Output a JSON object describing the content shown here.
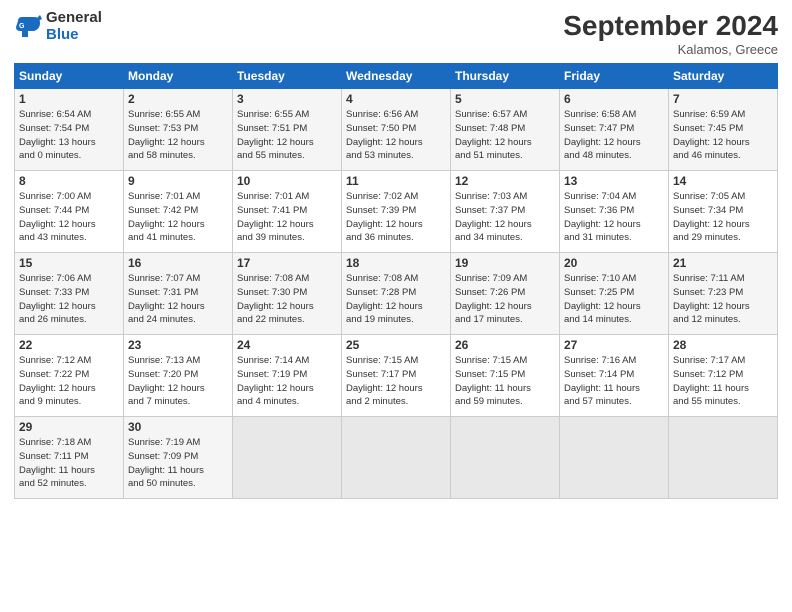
{
  "header": {
    "logo_general": "General",
    "logo_blue": "Blue",
    "title": "September 2024",
    "location": "Kalamos, Greece"
  },
  "weekdays": [
    "Sunday",
    "Monday",
    "Tuesday",
    "Wednesday",
    "Thursday",
    "Friday",
    "Saturday"
  ],
  "weeks": [
    [
      {
        "day": "1",
        "lines": [
          "Sunrise: 6:54 AM",
          "Sunset: 7:54 PM",
          "Daylight: 13 hours",
          "and 0 minutes."
        ]
      },
      {
        "day": "2",
        "lines": [
          "Sunrise: 6:55 AM",
          "Sunset: 7:53 PM",
          "Daylight: 12 hours",
          "and 58 minutes."
        ]
      },
      {
        "day": "3",
        "lines": [
          "Sunrise: 6:55 AM",
          "Sunset: 7:51 PM",
          "Daylight: 12 hours",
          "and 55 minutes."
        ]
      },
      {
        "day": "4",
        "lines": [
          "Sunrise: 6:56 AM",
          "Sunset: 7:50 PM",
          "Daylight: 12 hours",
          "and 53 minutes."
        ]
      },
      {
        "day": "5",
        "lines": [
          "Sunrise: 6:57 AM",
          "Sunset: 7:48 PM",
          "Daylight: 12 hours",
          "and 51 minutes."
        ]
      },
      {
        "day": "6",
        "lines": [
          "Sunrise: 6:58 AM",
          "Sunset: 7:47 PM",
          "Daylight: 12 hours",
          "and 48 minutes."
        ]
      },
      {
        "day": "7",
        "lines": [
          "Sunrise: 6:59 AM",
          "Sunset: 7:45 PM",
          "Daylight: 12 hours",
          "and 46 minutes."
        ]
      }
    ],
    [
      {
        "day": "8",
        "lines": [
          "Sunrise: 7:00 AM",
          "Sunset: 7:44 PM",
          "Daylight: 12 hours",
          "and 43 minutes."
        ]
      },
      {
        "day": "9",
        "lines": [
          "Sunrise: 7:01 AM",
          "Sunset: 7:42 PM",
          "Daylight: 12 hours",
          "and 41 minutes."
        ]
      },
      {
        "day": "10",
        "lines": [
          "Sunrise: 7:01 AM",
          "Sunset: 7:41 PM",
          "Daylight: 12 hours",
          "and 39 minutes."
        ]
      },
      {
        "day": "11",
        "lines": [
          "Sunrise: 7:02 AM",
          "Sunset: 7:39 PM",
          "Daylight: 12 hours",
          "and 36 minutes."
        ]
      },
      {
        "day": "12",
        "lines": [
          "Sunrise: 7:03 AM",
          "Sunset: 7:37 PM",
          "Daylight: 12 hours",
          "and 34 minutes."
        ]
      },
      {
        "day": "13",
        "lines": [
          "Sunrise: 7:04 AM",
          "Sunset: 7:36 PM",
          "Daylight: 12 hours",
          "and 31 minutes."
        ]
      },
      {
        "day": "14",
        "lines": [
          "Sunrise: 7:05 AM",
          "Sunset: 7:34 PM",
          "Daylight: 12 hours",
          "and 29 minutes."
        ]
      }
    ],
    [
      {
        "day": "15",
        "lines": [
          "Sunrise: 7:06 AM",
          "Sunset: 7:33 PM",
          "Daylight: 12 hours",
          "and 26 minutes."
        ]
      },
      {
        "day": "16",
        "lines": [
          "Sunrise: 7:07 AM",
          "Sunset: 7:31 PM",
          "Daylight: 12 hours",
          "and 24 minutes."
        ]
      },
      {
        "day": "17",
        "lines": [
          "Sunrise: 7:08 AM",
          "Sunset: 7:30 PM",
          "Daylight: 12 hours",
          "and 22 minutes."
        ]
      },
      {
        "day": "18",
        "lines": [
          "Sunrise: 7:08 AM",
          "Sunset: 7:28 PM",
          "Daylight: 12 hours",
          "and 19 minutes."
        ]
      },
      {
        "day": "19",
        "lines": [
          "Sunrise: 7:09 AM",
          "Sunset: 7:26 PM",
          "Daylight: 12 hours",
          "and 17 minutes."
        ]
      },
      {
        "day": "20",
        "lines": [
          "Sunrise: 7:10 AM",
          "Sunset: 7:25 PM",
          "Daylight: 12 hours",
          "and 14 minutes."
        ]
      },
      {
        "day": "21",
        "lines": [
          "Sunrise: 7:11 AM",
          "Sunset: 7:23 PM",
          "Daylight: 12 hours",
          "and 12 minutes."
        ]
      }
    ],
    [
      {
        "day": "22",
        "lines": [
          "Sunrise: 7:12 AM",
          "Sunset: 7:22 PM",
          "Daylight: 12 hours",
          "and 9 minutes."
        ]
      },
      {
        "day": "23",
        "lines": [
          "Sunrise: 7:13 AM",
          "Sunset: 7:20 PM",
          "Daylight: 12 hours",
          "and 7 minutes."
        ]
      },
      {
        "day": "24",
        "lines": [
          "Sunrise: 7:14 AM",
          "Sunset: 7:19 PM",
          "Daylight: 12 hours",
          "and 4 minutes."
        ]
      },
      {
        "day": "25",
        "lines": [
          "Sunrise: 7:15 AM",
          "Sunset: 7:17 PM",
          "Daylight: 12 hours",
          "and 2 minutes."
        ]
      },
      {
        "day": "26",
        "lines": [
          "Sunrise: 7:15 AM",
          "Sunset: 7:15 PM",
          "Daylight: 11 hours",
          "and 59 minutes."
        ]
      },
      {
        "day": "27",
        "lines": [
          "Sunrise: 7:16 AM",
          "Sunset: 7:14 PM",
          "Daylight: 11 hours",
          "and 57 minutes."
        ]
      },
      {
        "day": "28",
        "lines": [
          "Sunrise: 7:17 AM",
          "Sunset: 7:12 PM",
          "Daylight: 11 hours",
          "and 55 minutes."
        ]
      }
    ],
    [
      {
        "day": "29",
        "lines": [
          "Sunrise: 7:18 AM",
          "Sunset: 7:11 PM",
          "Daylight: 11 hours",
          "and 52 minutes."
        ]
      },
      {
        "day": "30",
        "lines": [
          "Sunrise: 7:19 AM",
          "Sunset: 7:09 PM",
          "Daylight: 11 hours",
          "and 50 minutes."
        ]
      },
      null,
      null,
      null,
      null,
      null
    ]
  ]
}
